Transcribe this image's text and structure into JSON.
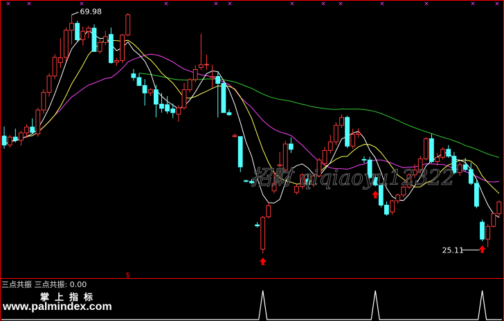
{
  "watermark": "招财  qiqiaoyu12322",
  "indicator": {
    "name": "三点共振",
    "value_label": "三点共振:",
    "value": "0.00"
  },
  "brand": {
    "cn": "掌上指标",
    "site": "www.palmindex.com"
  },
  "colors": {
    "bg": "#000000",
    "up": "#ff3b3b",
    "down": "#54ffff",
    "ma5": "#ffffff",
    "ma10": "#ffff55",
    "ma20": "#ff44ff",
    "ma60": "#33cc33",
    "axis": "#ff0000",
    "signal": "#ff0000",
    "wave": "#ffffff",
    "marker": "#ff44ff"
  },
  "chart_data": [
    {
      "type": "candlestick",
      "annotations": {
        "high_label": "69.98",
        "low_label": "25.11",
        "signal_glyph": "$"
      },
      "ylim": [
        21,
        72
      ],
      "ohlc": [
        [
          47.2,
          49.0,
          44.8,
          45.5
        ],
        [
          45.5,
          47.4,
          45.0,
          47.0
        ],
        [
          47.0,
          48.6,
          46.0,
          46.4
        ],
        [
          46.4,
          48.2,
          45.4,
          47.8
        ],
        [
          47.8,
          49.4,
          46.8,
          48.9
        ],
        [
          48.9,
          50.5,
          47.6,
          47.9
        ],
        [
          47.6,
          52.5,
          47.1,
          52.1
        ],
        [
          52.1,
          56.0,
          51.4,
          55.4
        ],
        [
          55.4,
          59.0,
          54.6,
          58.5
        ],
        [
          58.5,
          62.6,
          57.9,
          62.0
        ],
        [
          61.0,
          65.6,
          60.0,
          61.9
        ],
        [
          62.0,
          67.6,
          61.1,
          67.1
        ],
        [
          67.1,
          69.98,
          64.4,
          68.4
        ],
        [
          68.4,
          68.9,
          64.8,
          65.3
        ],
        [
          65.3,
          67.8,
          64.2,
          66.9
        ],
        [
          66.9,
          67.9,
          65.6,
          67.5
        ],
        [
          67.5,
          68.2,
          64.8,
          63.1
        ],
        [
          63.1,
          65.3,
          62.7,
          64.8
        ],
        [
          64.8,
          67.0,
          64.3,
          65.9
        ],
        [
          66.3,
          67.6,
          60.8,
          61.0
        ],
        [
          61.1,
          61.9,
          60.4,
          61.4
        ],
        [
          61.4,
          66.4,
          60.9,
          66.2
        ],
        [
          66.2,
          70.3,
          66.0,
          70.0
        ],
        [
          58.9,
          59.8,
          57.6,
          58.2
        ],
        [
          58.2,
          59.0,
          56.6,
          56.7
        ],
        [
          56.7,
          57.9,
          52.9,
          55.3
        ],
        [
          55.3,
          56.2,
          54.7,
          55.9
        ],
        [
          55.9,
          56.8,
          50.7,
          53.2
        ],
        [
          53.2,
          55.3,
          51.6,
          52.4
        ],
        [
          53.1,
          54.7,
          51.4,
          51.9
        ],
        [
          52.3,
          53.3,
          50.6,
          51.6
        ],
        [
          51.3,
          53.0,
          49.9,
          52.5
        ],
        [
          52.5,
          57.2,
          52.2,
          55.9
        ],
        [
          55.9,
          58.1,
          55.4,
          57.8
        ],
        [
          57.8,
          60.5,
          57.3,
          59.7
        ],
        [
          60.1,
          66.4,
          59.6,
          60.6
        ],
        [
          60.6,
          62.5,
          59.6,
          60.7
        ],
        [
          58.2,
          60.6,
          56.3,
          58.4
        ],
        [
          58.4,
          59.4,
          50.7,
          57.1
        ],
        [
          57.1,
          57.5,
          52.0,
          51.6
        ],
        [
          51.6,
          52.2,
          51.0,
          51.2
        ],
        [
          47.1,
          47.7,
          46.9,
          47.3
        ],
        [
          47.1,
          45.6,
          40.4,
          41.4
        ],
        [
          38.8,
          39.0,
          38.5,
          38.7
        ],
        [
          38.7,
          39.1,
          38.2,
          38.4
        ],
        [
          30.5,
          31.0,
          30.0,
          30.3
        ],
        [
          25.9,
          32.2,
          25.11,
          31.9
        ],
        [
          32.0,
          34.7,
          31.7,
          34.1
        ],
        [
          36.9,
          40.6,
          36.4,
          38.3
        ],
        [
          41.6,
          44.2,
          41.3,
          41.8
        ],
        [
          40.8,
          46.3,
          40.3,
          45.7
        ],
        [
          45.7,
          46.9,
          44.0,
          44.7
        ],
        [
          36.6,
          38.1,
          36.2,
          37.7
        ],
        [
          37.7,
          40.2,
          37.2,
          39.9
        ],
        [
          39.1,
          40.0,
          37.5,
          38.1
        ],
        [
          38.1,
          40.0,
          37.6,
          39.7
        ],
        [
          39.7,
          43.1,
          39.4,
          42.7
        ],
        [
          42.0,
          45.2,
          41.5,
          44.5
        ],
        [
          44.5,
          47.4,
          43.9,
          46.1
        ],
        [
          46.1,
          49.8,
          45.5,
          49.2
        ],
        [
          49.2,
          51.3,
          48.7,
          50.7
        ],
        [
          50.7,
          51.0,
          44.9,
          45.3
        ],
        [
          45.3,
          48.6,
          44.8,
          47.5
        ],
        [
          47.5,
          48.7,
          46.9,
          47.8
        ],
        [
          42.8,
          43.4,
          42.1,
          42.7
        ],
        [
          42.7,
          43.3,
          39.1,
          39.4
        ],
        [
          39.4,
          39.9,
          37.7,
          38.0
        ],
        [
          38.0,
          38.3,
          33.8,
          34.2
        ],
        [
          34.2,
          34.9,
          32.2,
          32.5
        ],
        [
          32.9,
          35.2,
          32.4,
          35.0
        ],
        [
          35.0,
          36.4,
          34.5,
          36.1
        ],
        [
          36.1,
          37.9,
          35.6,
          37.6
        ],
        [
          37.6,
          40.2,
          37.2,
          39.9
        ],
        [
          39.9,
          41.9,
          39.3,
          40.8
        ],
        [
          40.8,
          43.5,
          40.2,
          42.9
        ],
        [
          42.9,
          47.0,
          42.6,
          46.7
        ],
        [
          46.7,
          47.6,
          42.1,
          42.4
        ],
        [
          42.4,
          44.0,
          41.6,
          43.2
        ],
        [
          43.2,
          45.1,
          42.8,
          44.7
        ],
        [
          44.7,
          45.5,
          43.1,
          43.4
        ],
        [
          43.4,
          44.2,
          40.0,
          40.3
        ],
        [
          40.3,
          42.3,
          39.7,
          41.8
        ],
        [
          41.8,
          43.1,
          40.6,
          40.9
        ],
        [
          40.9,
          42.2,
          38.0,
          38.3
        ],
        [
          38.3,
          38.9,
          33.6,
          34.0
        ],
        [
          31.0,
          31.5,
          27.4,
          27.8
        ],
        [
          27.8,
          30.6,
          26.3,
          30.2
        ],
        [
          30.2,
          32.8,
          30.0,
          32.6
        ],
        [
          32.6,
          35.1,
          31.8,
          34.8
        ]
      ]
    },
    {
      "type": "line",
      "name": "三点共振",
      "ylim": [
        0,
        1
      ],
      "x": [
        0,
        1,
        2,
        3,
        4,
        5,
        6,
        7,
        8,
        9,
        10,
        11,
        12,
        13,
        14,
        15,
        16,
        17,
        18,
        19,
        20,
        21,
        22,
        23,
        24,
        25,
        26,
        27,
        28,
        29,
        30,
        31,
        32,
        33,
        34,
        35,
        36,
        37,
        38,
        39,
        40,
        41,
        42,
        43,
        44,
        45,
        46,
        47,
        48,
        49,
        50,
        51,
        52,
        53,
        54,
        55,
        56,
        57,
        58,
        59,
        60,
        61,
        62,
        63,
        64,
        65,
        66,
        67,
        68,
        69,
        70,
        71,
        72,
        73,
        74,
        75,
        76,
        77,
        78,
        79,
        80,
        81,
        82,
        83,
        84,
        85,
        86,
        87,
        88
      ],
      "values": [
        0,
        0,
        0,
        0,
        0,
        0,
        0,
        0,
        0,
        0,
        0,
        0,
        0,
        0,
        0,
        0,
        0,
        0,
        0,
        0,
        0,
        0,
        0,
        0,
        0,
        0,
        0,
        0,
        0,
        0,
        0,
        0,
        0,
        0,
        0,
        0,
        0,
        0,
        0,
        0,
        0,
        0,
        0,
        0,
        0,
        0,
        1,
        0,
        0,
        0,
        0,
        0,
        0,
        0,
        0,
        0,
        0,
        0,
        0,
        0,
        0,
        0,
        0,
        0,
        0,
        0,
        1,
        0,
        0,
        0,
        0,
        0,
        0,
        0,
        0,
        0,
        0,
        0,
        0,
        0,
        0,
        0,
        0,
        0,
        0,
        1,
        0,
        0,
        0
      ]
    }
  ]
}
